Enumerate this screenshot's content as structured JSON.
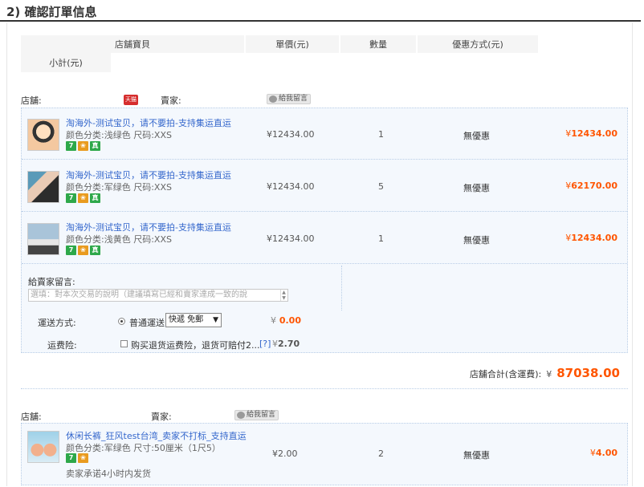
{
  "section_title": "2) 確認訂單信息",
  "headers": {
    "item": "店舖寶貝",
    "price": "單價(元)",
    "qty": "數量",
    "promo": "優惠方式(元)",
    "subtotal": "小計(元)"
  },
  "shops": [
    {
      "shop_label": "店舖:",
      "tmall_badge": "天猫",
      "seller_label": "賣家:",
      "message_button": "給我留言",
      "items": [
        {
          "title": "淘海外-测试宝贝，请不要拍-支持集运直运",
          "spec": "颜色分类:浅绿色   尺码:XXS",
          "price": "¥12434.00",
          "qty": "1",
          "promo": "無優惠",
          "subtotal_yen": "¥",
          "subtotal": "12434.00"
        },
        {
          "title": "淘海外-测试宝贝，请不要拍-支持集运直运",
          "spec": "颜色分类:军绿色   尺码:XXS",
          "price": "¥12434.00",
          "qty": "5",
          "promo": "無優惠",
          "subtotal_yen": "¥",
          "subtotal": "62170.00"
        },
        {
          "title": "淘海外-测试宝贝，请不要拍-支持集运直运",
          "spec": "颜色分类:浅黄色   尺码:XXS",
          "price": "¥12434.00",
          "qty": "1",
          "promo": "無優惠",
          "subtotal_yen": "¥",
          "subtotal": "12434.00"
        }
      ],
      "buyer_message_label": "給賣家留言:",
      "buyer_message_placeholder": "選填：對本次交易的說明（建議填寫已經和賣家達成一致的說",
      "shipping_label": "運送方式:",
      "shipping_option": "普通運送",
      "shipping_select": "快遞 免郵",
      "shipping_fee_yen": "¥",
      "shipping_fee": "0.00",
      "insurance_label": "运费险:",
      "insurance_text": "购买退货运费险，退货可赔付2...",
      "insurance_help": "[?]",
      "insurance_fee_yen": "¥",
      "insurance_fee": "2.70",
      "total_label": "店舖合計(含運費):",
      "total_yen": "¥",
      "total": "87038.00"
    },
    {
      "shop_label": "店舖:",
      "seller_label": "賣家:",
      "message_button": "給我留言",
      "items": [
        {
          "title": "休闲长裤_狂风test台湾_卖家不打标_支持直运",
          "spec": "颜色分类:军绿色   尺寸:50厘米（1尺5）",
          "price": "¥2.00",
          "qty": "2",
          "promo": "無優惠",
          "subtotal_yen": "¥",
          "subtotal": "4.00",
          "note": "卖家承诺4小时内发货"
        }
      ]
    }
  ],
  "badge_glyphs": {
    "seven": "7",
    "leaf": "❀",
    "hk": "真"
  },
  "colors": {
    "link": "#3366cc",
    "accent": "#ff5500",
    "box_bg": "#f4f8fd"
  }
}
